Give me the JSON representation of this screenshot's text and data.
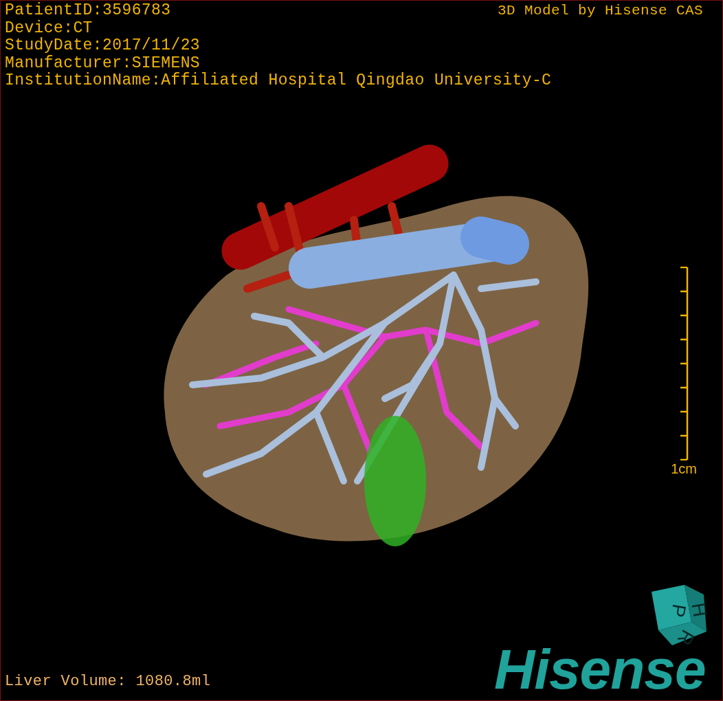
{
  "study_info": [
    "PatientID:3596783",
    "Device:CT",
    "StudyDate:2017/11/23",
    "Manufacturer:SIEMENS",
    "InstitutionName:Affiliated Hospital Qingdao University-C"
  ],
  "title": "3D Model by Hisense CAS",
  "scale_bar": {
    "label": "1cm"
  },
  "volume": "Liver Volume: 1080.8ml",
  "orientation_cube": {
    "faces": [
      "P",
      "H",
      "R"
    ]
  },
  "logo": "Hisense"
}
